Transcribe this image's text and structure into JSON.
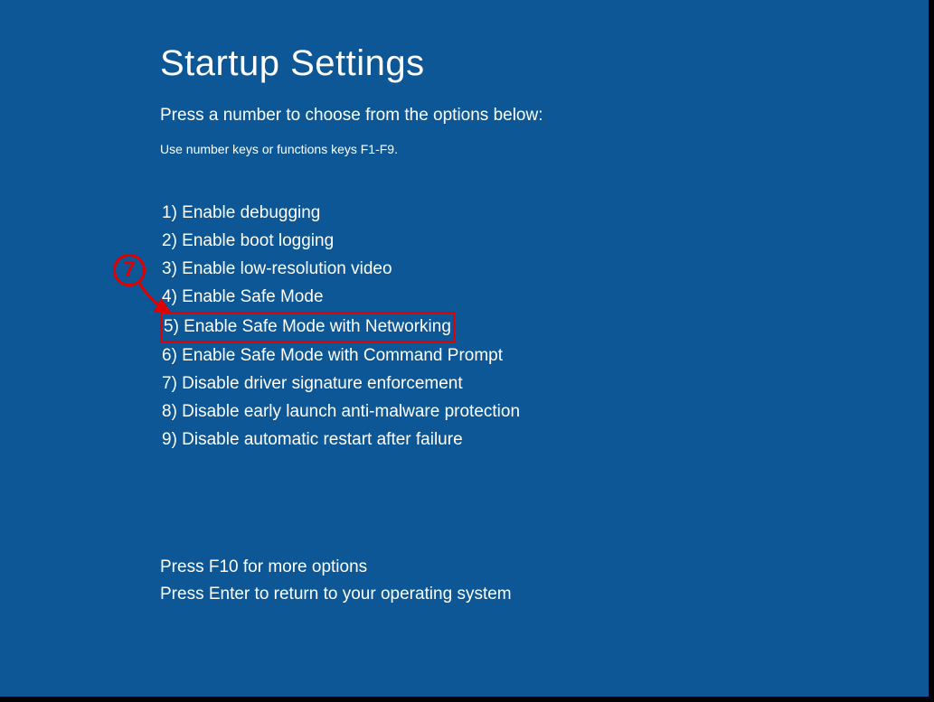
{
  "title": "Startup Settings",
  "subtitle": "Press a number to choose from the options below:",
  "hint": "Use number keys or functions keys F1-F9.",
  "options": [
    {
      "num": "1)",
      "label": "Enable debugging",
      "highlighted": false
    },
    {
      "num": "2)",
      "label": "Enable boot logging",
      "highlighted": false
    },
    {
      "num": "3)",
      "label": "Enable low-resolution video",
      "highlighted": false
    },
    {
      "num": "4)",
      "label": "Enable Safe Mode",
      "highlighted": false
    },
    {
      "num": "5)",
      "label": "Enable Safe Mode with Networking",
      "highlighted": true
    },
    {
      "num": "6)",
      "label": "Enable Safe Mode with Command Prompt",
      "highlighted": false
    },
    {
      "num": "7)",
      "label": "Disable driver signature enforcement",
      "highlighted": false
    },
    {
      "num": "8)",
      "label": "Disable early launch anti-malware protection",
      "highlighted": false
    },
    {
      "num": "9)",
      "label": "Disable automatic restart after failure",
      "highlighted": false
    }
  ],
  "footer": {
    "more": "Press F10 for more options",
    "return": "Press Enter to return to your operating system"
  },
  "annotation": {
    "number": "7"
  }
}
